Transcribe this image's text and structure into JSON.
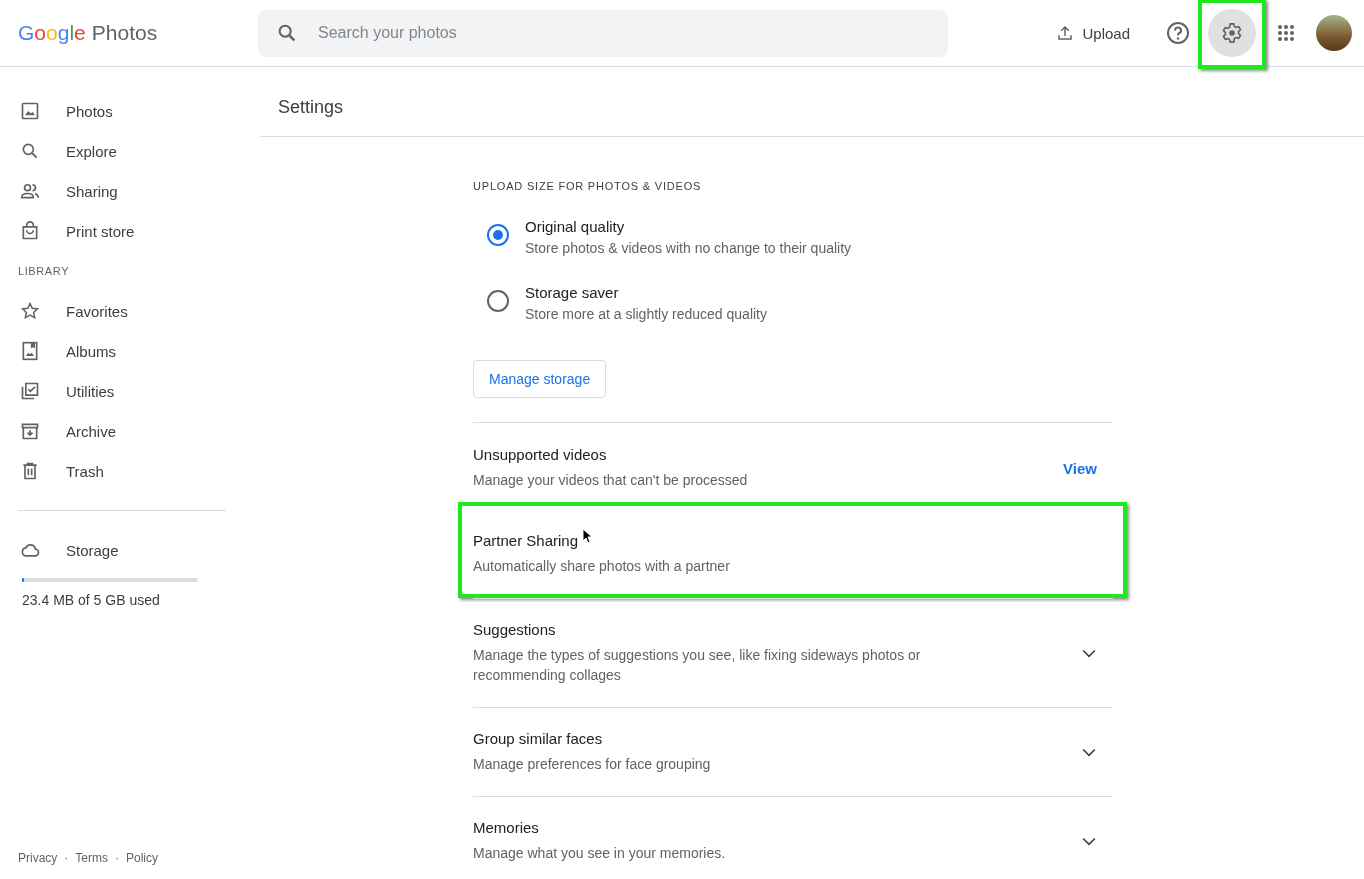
{
  "header": {
    "logo_word": "Google",
    "product": "Photos",
    "search": {
      "placeholder": "Search your photos"
    },
    "upload": "Upload",
    "settings_button": {
      "highlighted": true
    }
  },
  "sidebar": {
    "items": [
      {
        "label": "Photos",
        "selected": false
      },
      {
        "label": "Explore",
        "selected": false
      },
      {
        "label": "Sharing",
        "selected": false
      },
      {
        "label": "Print store",
        "selected": false
      }
    ],
    "library_label": "LIBRARY",
    "library_items": [
      {
        "label": "Favorites",
        "selected": false
      },
      {
        "label": "Albums",
        "selected": false
      },
      {
        "label": "Utilities",
        "selected": false
      },
      {
        "label": "Archive",
        "selected": false
      },
      {
        "label": "Trash",
        "selected": false
      }
    ],
    "storage": {
      "label": "Storage",
      "level": 0.01,
      "usage": "23.4 MB of 5 GB used"
    },
    "footer": [
      "Privacy",
      "Terms",
      "Policy"
    ],
    "footer_separator": "·"
  },
  "page_title": "Settings",
  "upload_size": {
    "heading": "UPLOAD SIZE FOR PHOTOS & VIDEOS",
    "options": [
      {
        "title": "Original quality",
        "subtitle": "Store photos & videos with no change to their quality",
        "selected": true
      },
      {
        "title": "Storage saver",
        "subtitle": "Store more at a slightly reduced quality",
        "selected": false
      }
    ],
    "manage_button": "Manage storage"
  },
  "rows": [
    {
      "kind": "link",
      "title": "Unsupported videos",
      "subtitle": "Manage your videos that can't be processed",
      "action": "View",
      "highlighted": false
    },
    {
      "kind": "plain",
      "title": "Partner Sharing",
      "subtitle": "Automatically share photos with a partner",
      "highlighted": true
    },
    {
      "kind": "expandable",
      "title": "Suggestions",
      "subtitle": "Manage the types of suggestions you see, like fixing sideways photos or recommending collages",
      "expanded": false,
      "highlighted": false
    },
    {
      "kind": "expandable",
      "title": "Group similar faces",
      "subtitle": "Manage preferences for face grouping",
      "expanded": false,
      "highlighted": false
    },
    {
      "kind": "expandable",
      "title": "Memories",
      "subtitle": "Manage what you see in your memories.",
      "expanded": false,
      "highlighted": false
    }
  ]
}
